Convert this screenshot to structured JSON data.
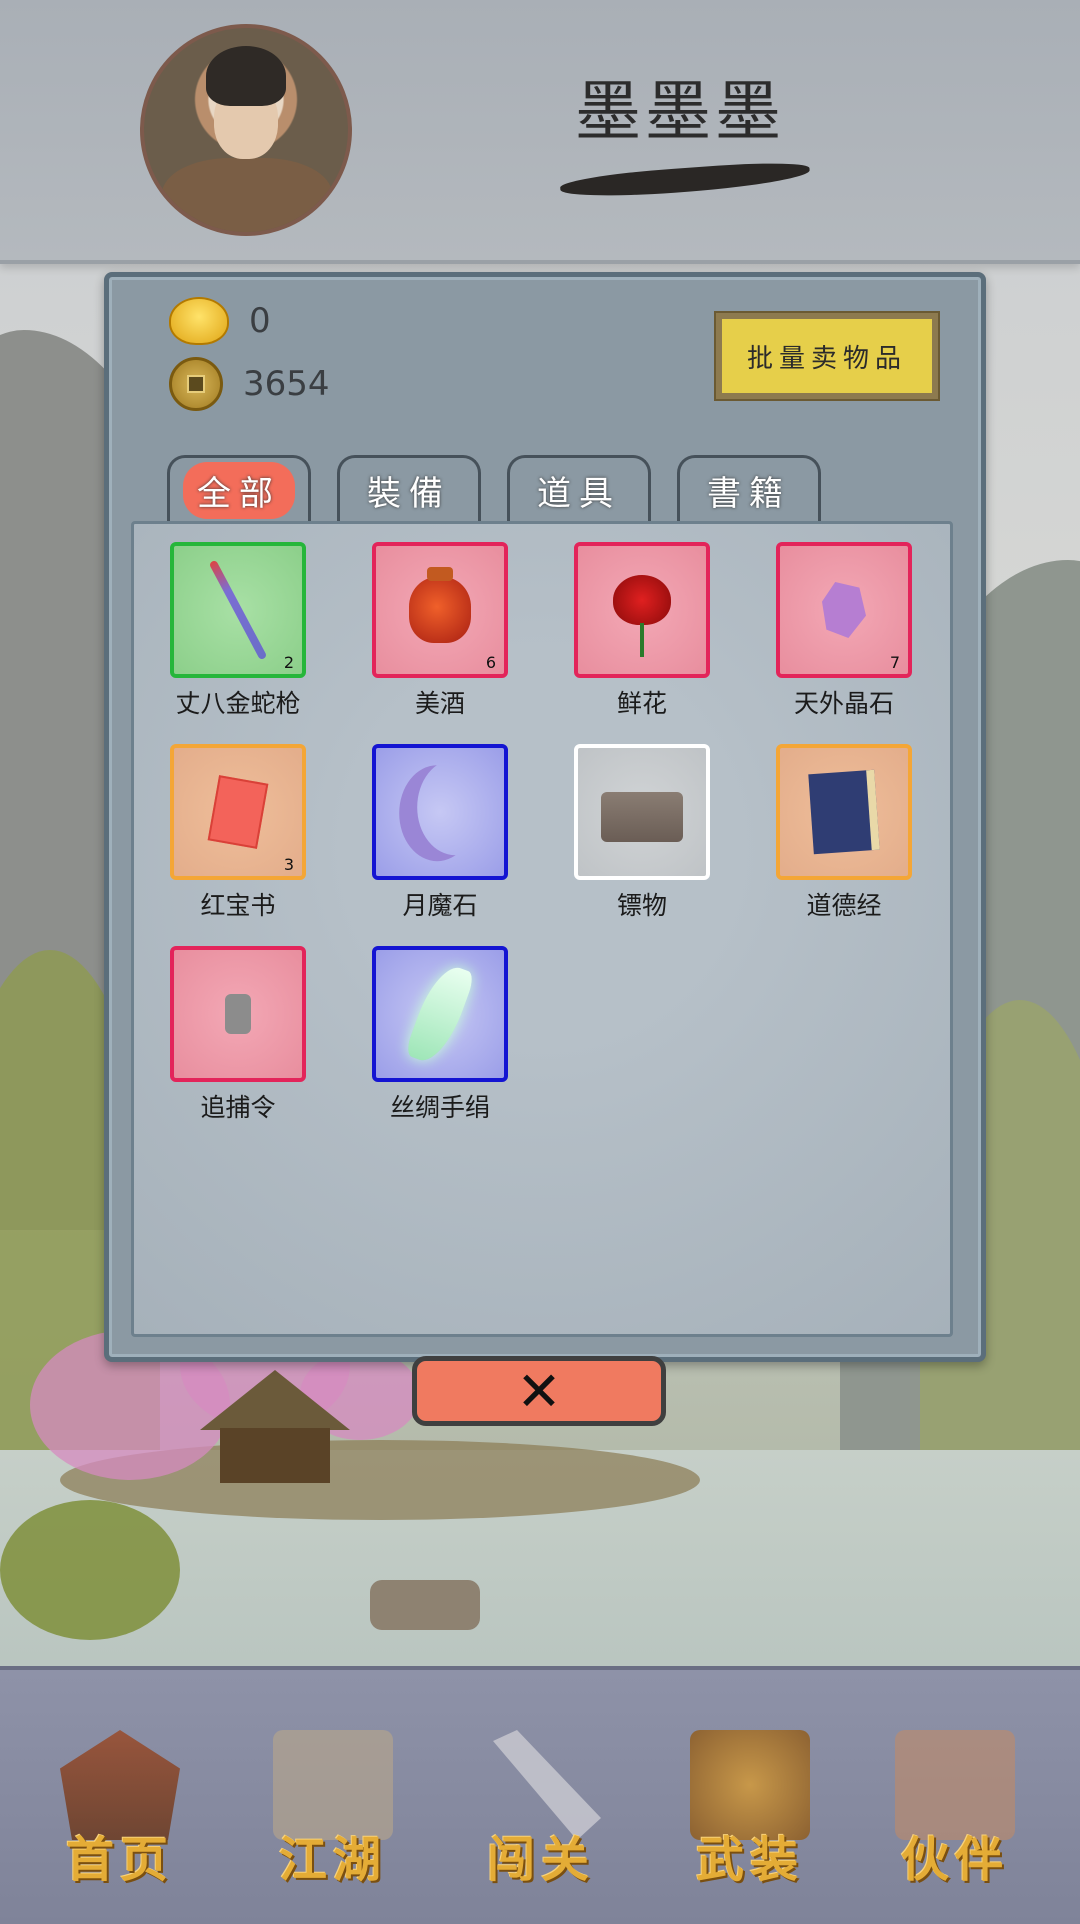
{
  "player": {
    "name": "墨墨墨"
  },
  "currency": {
    "gold": "0",
    "copper": "3654"
  },
  "actions": {
    "batch_sell_label": "批量卖物品",
    "close_label": "✕"
  },
  "tabs": [
    {
      "label": "全部",
      "active": true
    },
    {
      "label": "裝備",
      "active": false
    },
    {
      "label": "道具",
      "active": false
    },
    {
      "label": "書籍",
      "active": false
    }
  ],
  "items": [
    {
      "name": "丈八金蛇枪",
      "count": "2",
      "quality": "green",
      "icon": "spear-icon"
    },
    {
      "name": "美酒",
      "count": "6",
      "quality": "red",
      "icon": "wine-jar-icon"
    },
    {
      "name": "鲜花",
      "count": "",
      "quality": "red",
      "icon": "rose-icon"
    },
    {
      "name": "天外晶石",
      "count": "7",
      "quality": "red",
      "icon": "crystal-icon"
    },
    {
      "name": "红宝书",
      "count": "3",
      "quality": "orange",
      "icon": "red-book-icon"
    },
    {
      "name": "月魔石",
      "count": "",
      "quality": "blue",
      "icon": "crescent-moon-icon"
    },
    {
      "name": "镖物",
      "count": "",
      "quality": "white",
      "icon": "escort-box-icon"
    },
    {
      "name": "道德经",
      "count": "",
      "quality": "orange",
      "icon": "scripture-book-icon"
    },
    {
      "name": "追捕令",
      "count": "",
      "quality": "red",
      "icon": "token-icon"
    },
    {
      "name": "丝绸手绢",
      "count": "",
      "quality": "blue",
      "icon": "silk-handkerchief-icon"
    }
  ],
  "nav": [
    {
      "label": "首页",
      "icon": "house-icon"
    },
    {
      "label": "江湖",
      "icon": "scroll-map-icon"
    },
    {
      "label": "闯关",
      "icon": "crossed-swords-icon"
    },
    {
      "label": "武装",
      "icon": "armor-icon"
    },
    {
      "label": "伙伴",
      "icon": "companions-icon"
    }
  ],
  "colors": {
    "quality_green": "#26b63a",
    "quality_red": "#e3245a",
    "quality_orange": "#f4a636",
    "quality_blue": "#1414d2",
    "quality_white": "#ffffff",
    "active_tab": "#f36d5a",
    "sell_button": "#e6cf4a",
    "close_button": "#f07a60",
    "nav_text": "#e4ac36"
  }
}
